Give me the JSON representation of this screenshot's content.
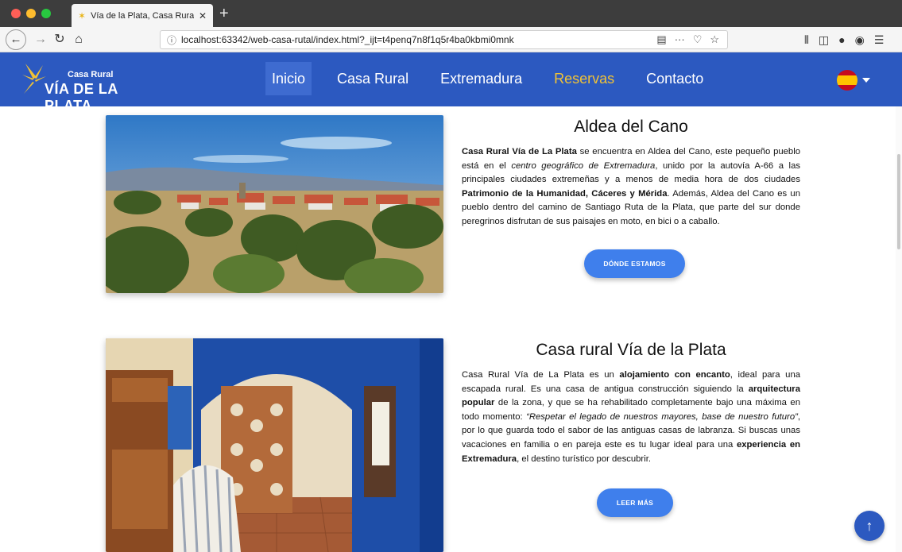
{
  "browser": {
    "tab_title": "Vía de la Plata, Casa Rural en E",
    "tab_close": "✕",
    "new_tab": "+",
    "url": "localhost:63342/web-casa-rutal/index.html?_ijt=t4penq7n8f1q5r4ba0kbmi0mnk",
    "url_actions": "···",
    "icons": [
      "back-icon",
      "forward-icon",
      "reload-icon",
      "home-icon",
      "reader-icon",
      "pocket-icon",
      "bookmark-icon",
      "library-icon",
      "sidebar-icon",
      "extension-icon",
      "account-icon",
      "menu-icon"
    ]
  },
  "site": {
    "logo_small": "Casa Rural",
    "logo_big": "VÍA DE LA PLATA",
    "menu": [
      "Inicio",
      "Casa Rural",
      "Extremadura",
      "Reservas",
      "Contacto"
    ],
    "active_menu": "Inicio",
    "highlight_menu": "Reservas",
    "brand_color": "#2c59c0",
    "accent_color": "#f0c236",
    "button_color": "#3f7fec"
  },
  "sections": [
    {
      "title": "Aldea del Cano",
      "button": "DÓNDE ESTAMOS",
      "paragraph": [
        {
          "t": "Casa Rural Vía de La Plata",
          "s": "b"
        },
        {
          "t": " se encuentra en Aldea del Cano, este pequeño pueblo está en el "
        },
        {
          "t": "centro geográfico de Extremadura",
          "s": "i"
        },
        {
          "t": ", unido por la autovía A-66 a las principales ciudades extremeñas y a menos de media hora de dos ciudades "
        },
        {
          "t": "Patrimonio de la Humanidad, Cáceres y Mérida",
          "s": "b"
        },
        {
          "t": ". Además, Aldea del Cano es un pueblo dentro del camino de Santiago Ruta de la Plata, que parte del sur donde peregrinos disfrutan de sus paisajes en moto, en bici o a caballo."
        }
      ]
    },
    {
      "title": "Casa rural Vía de la Plata",
      "button": "LEER MÁS",
      "paragraph": [
        {
          "t": "Casa Rural Vía de La Plata es un "
        },
        {
          "t": "alojamiento con encanto",
          "s": "b"
        },
        {
          "t": ", ideal para una escapada rural. Es una casa de antigua construcción siguiendo la "
        },
        {
          "t": "arquitectura popular",
          "s": "b"
        },
        {
          "t": " de la zona, y que se ha rehabilitado completamente bajo una máxima en todo momento: "
        },
        {
          "t": "“Respetar el legado de nuestros mayores, base de nuestro futuro”",
          "s": "i"
        },
        {
          "t": ", por lo que guarda todo el sabor de las antiguas casas de labranza. Si buscas unas vacaciones en familia o en pareja este es tu lugar ideal para una "
        },
        {
          "t": "experiencia en Extremadura",
          "s": "b"
        },
        {
          "t": ", el destino turístico por descubrir."
        }
      ]
    }
  ],
  "back_to_top": "↑"
}
